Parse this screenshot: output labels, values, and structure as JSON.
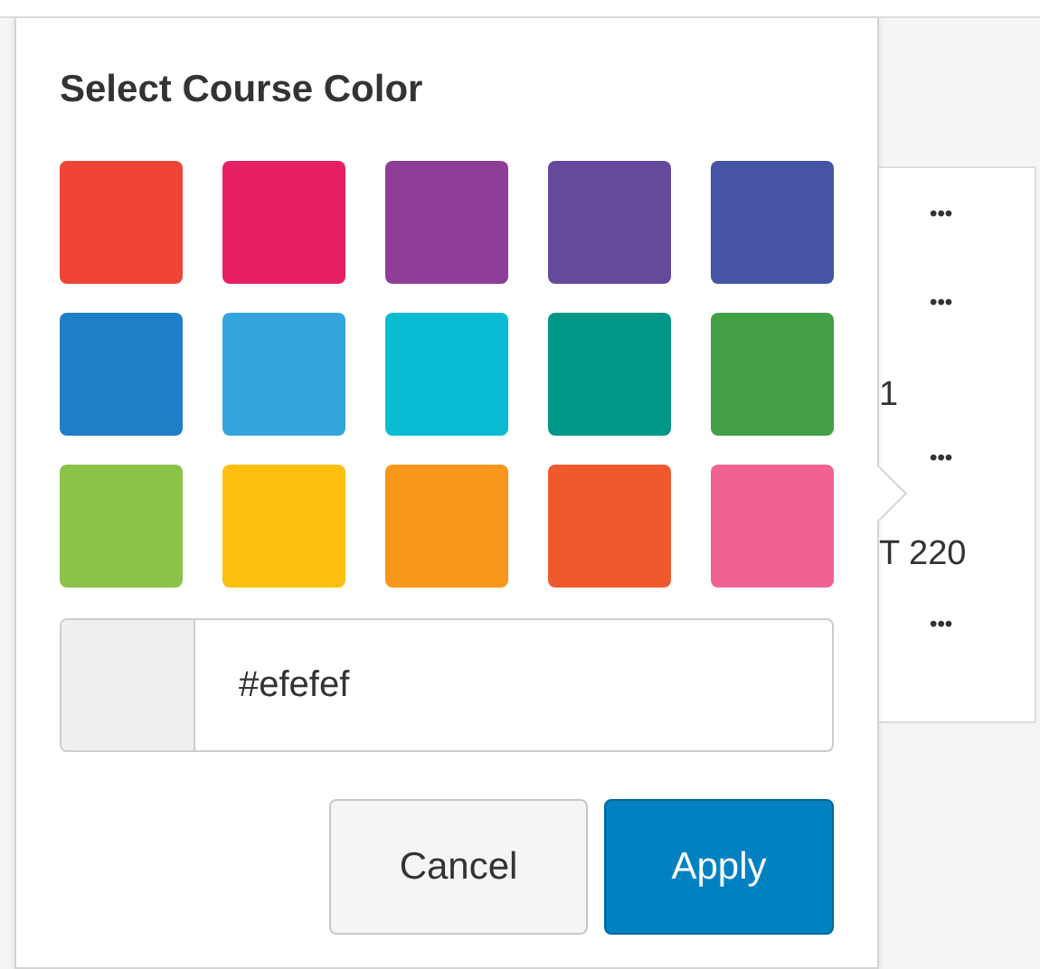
{
  "popover": {
    "title": "Select Course Color",
    "swatches": [
      {
        "color": "#ef4437"
      },
      {
        "color": "#e71f63"
      },
      {
        "color": "#8f3e97"
      },
      {
        "color": "#65499d"
      },
      {
        "color": "#4554a4"
      },
      {
        "color": "#1f7fc6"
      },
      {
        "color": "#35a4dc"
      },
      {
        "color": "#09bcd3"
      },
      {
        "color": "#009688"
      },
      {
        "color": "#43a047"
      },
      {
        "color": "#8bc34a"
      },
      {
        "color": "#fdc010"
      },
      {
        "color": "#f8971c"
      },
      {
        "color": "#f0592b"
      },
      {
        "color": "#f06291"
      }
    ],
    "hex_field": {
      "value": "#efefef"
    },
    "buttons": [
      {
        "label": "Cancel",
        "kind": "secondary"
      },
      {
        "label": "Apply",
        "kind": "primary"
      }
    ]
  },
  "background_card": {
    "items": [
      {
        "kind": "menu",
        "text": "•••"
      },
      {
        "kind": "menu",
        "text": "•••"
      },
      {
        "kind": "label",
        "text": "1"
      },
      {
        "kind": "menu",
        "text": "•••"
      },
      {
        "kind": "label",
        "text": "T 220"
      },
      {
        "kind": "menu",
        "text": "•••"
      }
    ]
  }
}
